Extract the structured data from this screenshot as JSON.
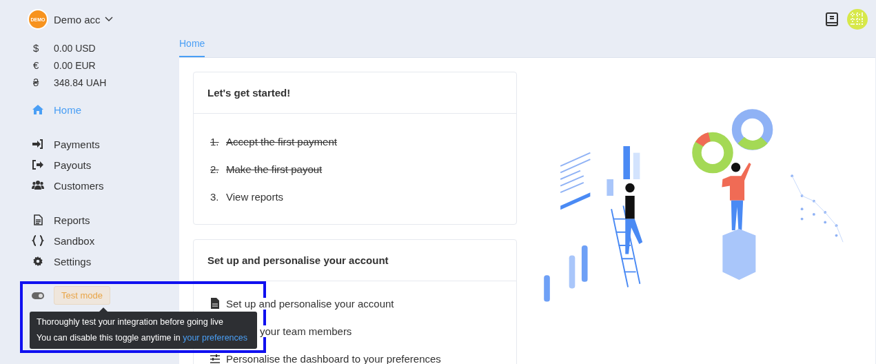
{
  "account": {
    "logo_text": "DEMO",
    "name": "Demo acc"
  },
  "balances": [
    {
      "symbol": "$",
      "amount": "0.00 USD"
    },
    {
      "symbol": "€",
      "amount": "0.00 EUR"
    },
    {
      "symbol": "₴",
      "amount": "348.84 UAH"
    }
  ],
  "nav": [
    {
      "items": [
        {
          "kind": "home",
          "label": "Home",
          "selected": true
        }
      ]
    },
    {
      "items": [
        {
          "kind": "in",
          "label": "Payments",
          "selected": false
        },
        {
          "kind": "out",
          "label": "Payouts",
          "selected": false
        },
        {
          "kind": "users",
          "label": "Customers",
          "selected": false
        }
      ]
    },
    {
      "items": [
        {
          "kind": "doc",
          "label": "Reports",
          "selected": false
        },
        {
          "kind": "braces",
          "label": "Sandbox",
          "selected": false
        },
        {
          "kind": "gear",
          "label": "Settings",
          "selected": false
        }
      ]
    }
  ],
  "test_mode": {
    "on": true,
    "label": "Test mode",
    "tooltip": {
      "line1": "Thoroughly test your integration before going live",
      "line2": "You can disable this toggle anytime in ",
      "link": "your preferences"
    }
  },
  "tabs": [
    {
      "label": "Home",
      "selected": true
    }
  ],
  "cards": [
    {
      "title": "Let's get started!",
      "items": [
        {
          "number": "1.",
          "text": "Accept the first payment",
          "done": true
        },
        {
          "number": "2.",
          "text": "Make the first payout",
          "done": true
        },
        {
          "number": "3.",
          "text": "View reports",
          "done": false
        }
      ]
    },
    {
      "title": "Set up and personalise your account",
      "items": [
        {
          "kind": "doc",
          "text": "Set up and personalise your account"
        },
        {
          "kind": "hidden",
          "text": "your team members"
        },
        {
          "kind": "sliders",
          "text": "Personalise the dashboard to your preferences"
        }
      ]
    }
  ]
}
